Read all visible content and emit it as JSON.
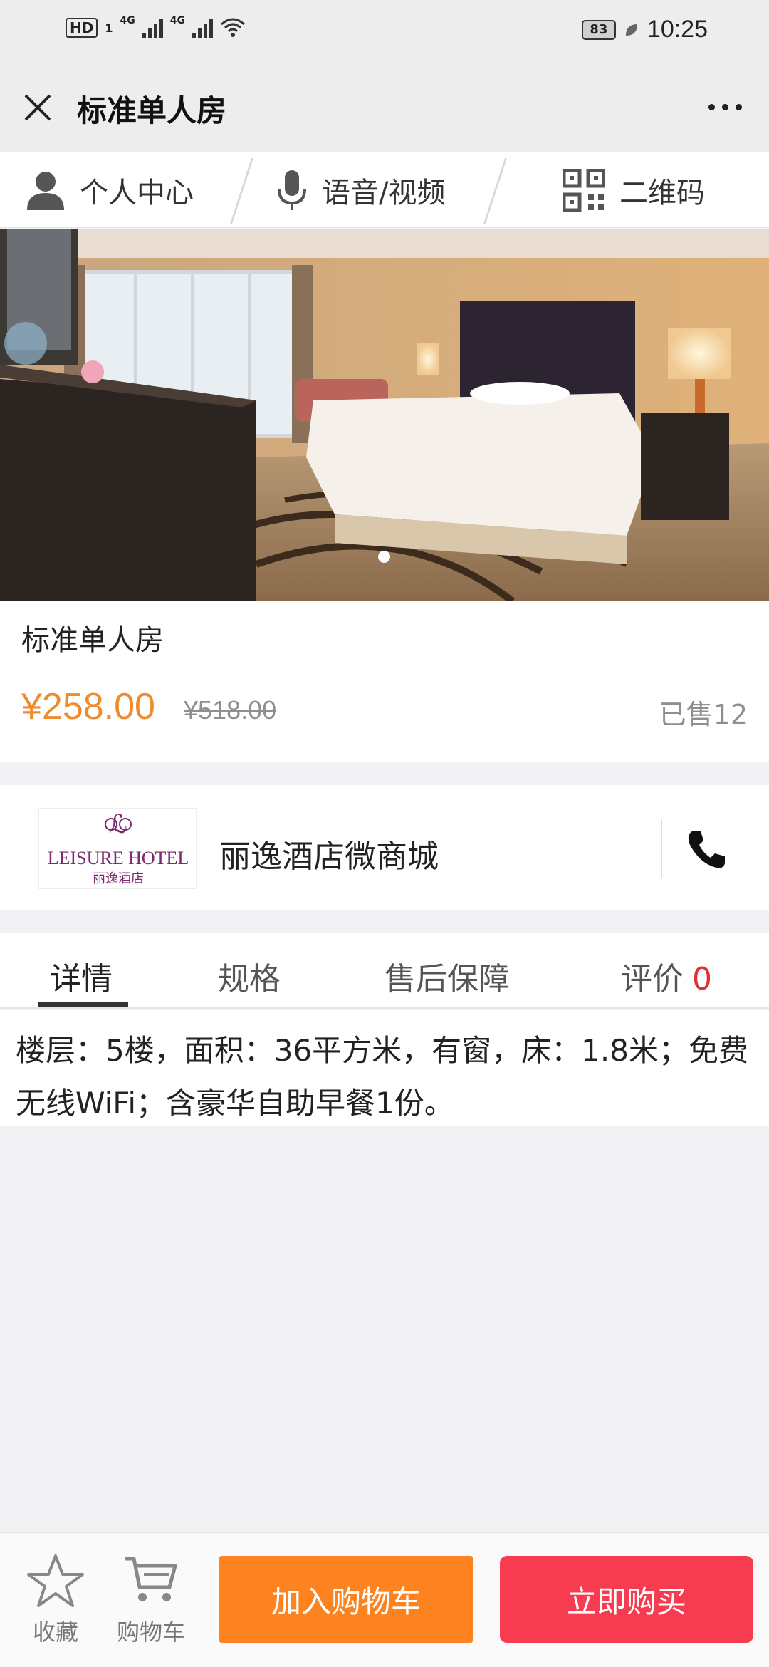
{
  "status_bar": {
    "hd": "HD",
    "sim": "1",
    "net1": "4G",
    "net2": "4G",
    "battery": "83",
    "time": "10:25"
  },
  "header": {
    "title": "标准单人房"
  },
  "top_nav": {
    "items": [
      {
        "label": "个人中心",
        "icon": "person-icon"
      },
      {
        "label": "语音/视频",
        "icon": "microphone-icon"
      },
      {
        "label": "二维码",
        "icon": "qr-code-icon"
      }
    ]
  },
  "hero": {
    "slide_count": 1,
    "active_slide": 1
  },
  "product": {
    "name": "标准单人房",
    "price": "¥258.00",
    "original_price": "¥518.00",
    "sold": "已售12"
  },
  "shop": {
    "name": "丽逸酒店微商城",
    "logo_text": "LEISURE HOTEL",
    "logo_subtext": "丽逸酒店"
  },
  "tabs": {
    "items": [
      {
        "label": "详情"
      },
      {
        "label": "规格"
      },
      {
        "label": "售后保障"
      },
      {
        "label": "评价",
        "count": "0"
      }
    ],
    "active_index": 0
  },
  "detail": {
    "text": "楼层：5楼，面积：36平方米，有窗，床：1.8米；免费无线WiFi；含豪华自助早餐1份。"
  },
  "bottom_bar": {
    "favorite_label": "收藏",
    "cart_label": "购物车",
    "add_to_cart": "加入购物车",
    "buy_now": "立即购买"
  },
  "colors": {
    "price": "#f08a2c",
    "add_to_cart_bg": "#fd8321",
    "buy_now_bg": "#f73c52",
    "review_count": "#e0312f"
  }
}
